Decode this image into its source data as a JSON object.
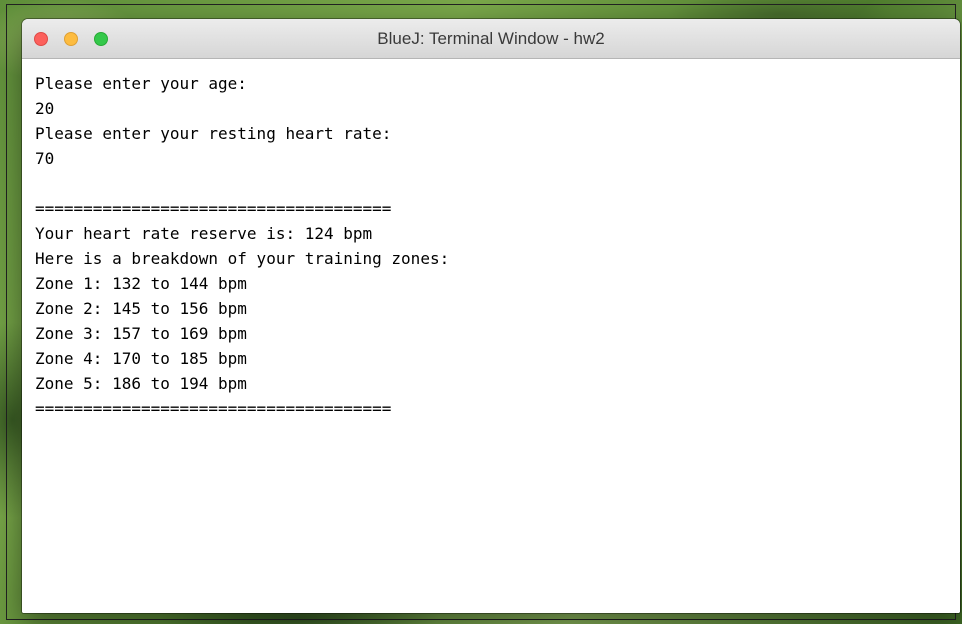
{
  "window": {
    "title": "BlueJ: Terminal Window - hw2",
    "controls": {
      "close_color": "#fc605c",
      "minimize_color": "#fdbc40",
      "zoom_color": "#34c84a"
    }
  },
  "terminal": {
    "lines": [
      "Please enter your age:",
      "20",
      "Please enter your resting heart rate:",
      "70",
      "",
      "=====================================",
      "Your heart rate reserve is: 124 bpm",
      "Here is a breakdown of your training zones:",
      "Zone 1: 132 to 144 bpm",
      "Zone 2: 145 to 156 bpm",
      "Zone 3: 157 to 169 bpm",
      "Zone 4: 170 to 185 bpm",
      "Zone 5: 186 to 194 bpm",
      "====================================="
    ]
  }
}
